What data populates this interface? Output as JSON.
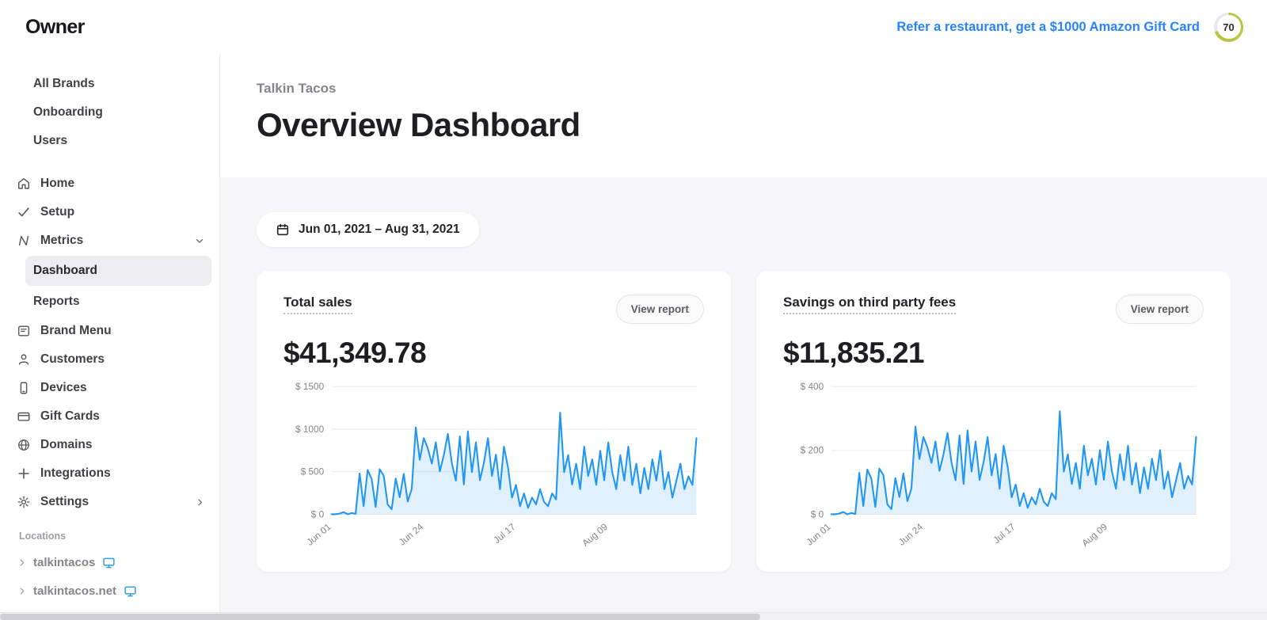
{
  "topbar": {
    "logo": "Owner",
    "referral_link": "Refer a restaurant, get a $1000 Amazon Gift Card",
    "score_badge": "70"
  },
  "sidebar": {
    "top_items": [
      {
        "label": "All Brands"
      },
      {
        "label": "Onboarding"
      },
      {
        "label": "Users"
      }
    ],
    "menu": [
      {
        "label": "Home"
      },
      {
        "label": "Setup"
      },
      {
        "label": "Metrics"
      },
      {
        "label": "Dashboard"
      },
      {
        "label": "Reports"
      },
      {
        "label": "Brand Menu"
      },
      {
        "label": "Customers"
      },
      {
        "label": "Devices"
      },
      {
        "label": "Gift Cards"
      },
      {
        "label": "Domains"
      },
      {
        "label": "Integrations"
      },
      {
        "label": "Settings"
      }
    ],
    "locations_label": "Locations",
    "locations": [
      {
        "label": "talkintacos"
      },
      {
        "label": "talkintacos.net"
      }
    ]
  },
  "header": {
    "brand": "Talkin Tacos",
    "title": "Overview Dashboard"
  },
  "filters": {
    "date_range": "Jun 01, 2021 – Aug 31, 2021"
  },
  "cards": [
    {
      "title": "Total sales",
      "action": "View report",
      "amount": "$41,349.78"
    },
    {
      "title": "Savings on third party fees",
      "action": "View report",
      "amount": "$11,835.21"
    }
  ],
  "colors": {
    "accent": "#2196f3",
    "link": "#2684fc",
    "area_fill": "rgba(33,150,243,0.14)",
    "grid": "#e9eaec"
  },
  "chart_data": [
    {
      "type": "line",
      "title": "Total sales",
      "xlabel": "",
      "ylabel": "$",
      "ylim": [
        0,
        1500
      ],
      "yticks": [
        0,
        500,
        1000,
        1500
      ],
      "ytick_prefix": "$ ",
      "x_range": "Jun 01, 2021 – Aug 31, 2021",
      "x_tick_labels": [
        "Jun 01",
        "Jun 24",
        "Jul 17",
        "Aug 09"
      ],
      "x_tick_indices": [
        0,
        23,
        46,
        69
      ],
      "grid": true,
      "legend": false,
      "values": [
        0,
        0,
        8,
        25,
        0,
        15,
        5,
        480,
        95,
        520,
        415,
        85,
        530,
        455,
        115,
        60,
        420,
        200,
        475,
        150,
        300,
        1020,
        640,
        895,
        775,
        595,
        845,
        505,
        695,
        945,
        600,
        395,
        915,
        350,
        975,
        495,
        845,
        400,
        605,
        895,
        450,
        700,
        295,
        795,
        550,
        195,
        345,
        95,
        245,
        75,
        195,
        115,
        295,
        145,
        95,
        245,
        175,
        1195,
        495,
        695,
        350,
        595,
        295,
        795,
        450,
        645,
        345,
        745,
        400,
        845,
        495,
        295,
        695,
        395,
        795,
        345,
        595,
        245,
        545,
        295,
        645,
        395,
        745,
        295,
        495,
        195,
        395,
        595,
        295,
        445,
        345,
        895
      ]
    },
    {
      "type": "line",
      "title": "Savings on third party fees",
      "xlabel": "",
      "ylabel": "$",
      "ylim": [
        0,
        400
      ],
      "yticks": [
        0,
        200,
        400
      ],
      "ytick_prefix": "$ ",
      "x_range": "Jun 01, 2021 – Aug 31, 2021",
      "x_tick_labels": [
        "Jun 01",
        "Jun 24",
        "Jul 17",
        "Aug 09"
      ],
      "x_tick_indices": [
        0,
        23,
        46,
        69
      ],
      "grid": true,
      "legend": false,
      "values": [
        0,
        0,
        2,
        7,
        0,
        4,
        1,
        130,
        26,
        140,
        112,
        23,
        143,
        123,
        31,
        16,
        113,
        54,
        128,
        41,
        81,
        275,
        173,
        242,
        209,
        161,
        228,
        136,
        188,
        255,
        162,
        107,
        247,
        95,
        263,
        134,
        228,
        108,
        163,
        242,
        122,
        189,
        80,
        215,
        149,
        53,
        93,
        26,
        66,
        20,
        53,
        31,
        80,
        39,
        26,
        66,
        47,
        323,
        134,
        188,
        95,
        161,
        80,
        215,
        122,
        174,
        93,
        201,
        108,
        228,
        134,
        80,
        188,
        107,
        215,
        93,
        161,
        66,
        147,
        80,
        174,
        107,
        201,
        80,
        134,
        53,
        107,
        161,
        80,
        120,
        93,
        242
      ]
    }
  ]
}
